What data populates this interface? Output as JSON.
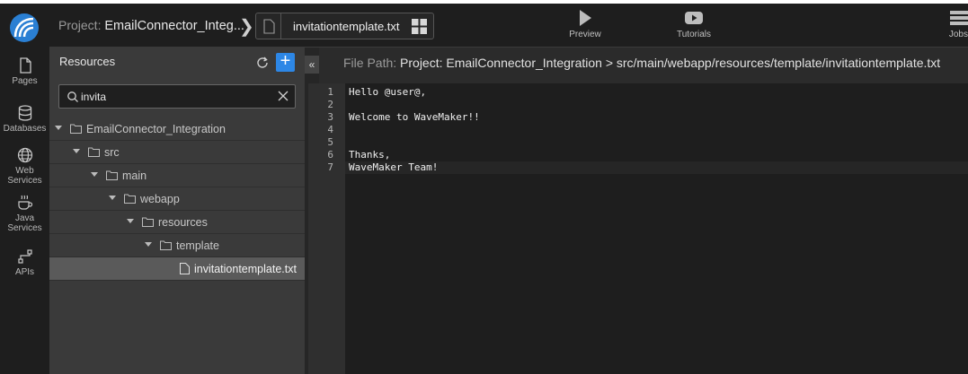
{
  "header": {
    "project_label": "Project:",
    "project_name": "EmailConnector_Integ...",
    "open_file": "invitationtemplate.txt",
    "buttons": [
      {
        "label": "Preview",
        "icon": "play-icon"
      },
      {
        "label": "Tutorials",
        "icon": "youtube-icon"
      },
      {
        "label": "Jobs",
        "icon": "jobs-icon"
      }
    ]
  },
  "nav": {
    "items": [
      {
        "label": "Pages",
        "icon": "pages-icon"
      },
      {
        "label": "Databases",
        "icon": "database-icon"
      },
      {
        "label_line1": "Web",
        "label_line2": "Services",
        "icon": "globe-icon"
      },
      {
        "label_line1": "Java",
        "label_line2": "Services",
        "icon": "coffee-icon"
      },
      {
        "label": "APIs",
        "icon": "apis-icon"
      }
    ]
  },
  "resources": {
    "title": "Resources",
    "search_value": "invita",
    "tree": [
      {
        "label": "EmailConnector_Integration",
        "depth": 0,
        "type": "folder"
      },
      {
        "label": "src",
        "depth": 1,
        "type": "folder"
      },
      {
        "label": "main",
        "depth": 2,
        "type": "folder"
      },
      {
        "label": "webapp",
        "depth": 3,
        "type": "folder"
      },
      {
        "label": "resources",
        "depth": 4,
        "type": "folder"
      },
      {
        "label": "template",
        "depth": 5,
        "type": "folder"
      },
      {
        "label": "invitationtemplate.txt",
        "depth": 6,
        "type": "file",
        "selected": true
      }
    ]
  },
  "editor": {
    "path_label": "File Path:",
    "path_value": "Project: EmailConnector_Integration > src/main/webapp/resources/template/invitationtemplate.txt",
    "lines": [
      {
        "num": "1",
        "text": "Hello @user@,"
      },
      {
        "num": "2",
        "text": ""
      },
      {
        "num": "3",
        "text": "Welcome to WaveMaker!!"
      },
      {
        "num": "4",
        "text": ""
      },
      {
        "num": "5",
        "text": ""
      },
      {
        "num": "6",
        "text": "Thanks,"
      },
      {
        "num": "7",
        "text": "WaveMaker Team!"
      }
    ]
  },
  "colors": {
    "accent": "#2d87e6",
    "rail_bg": "#1e1e1e",
    "panel_bg": "#3a3a3a",
    "editor_bg": "#1e1e1e"
  }
}
